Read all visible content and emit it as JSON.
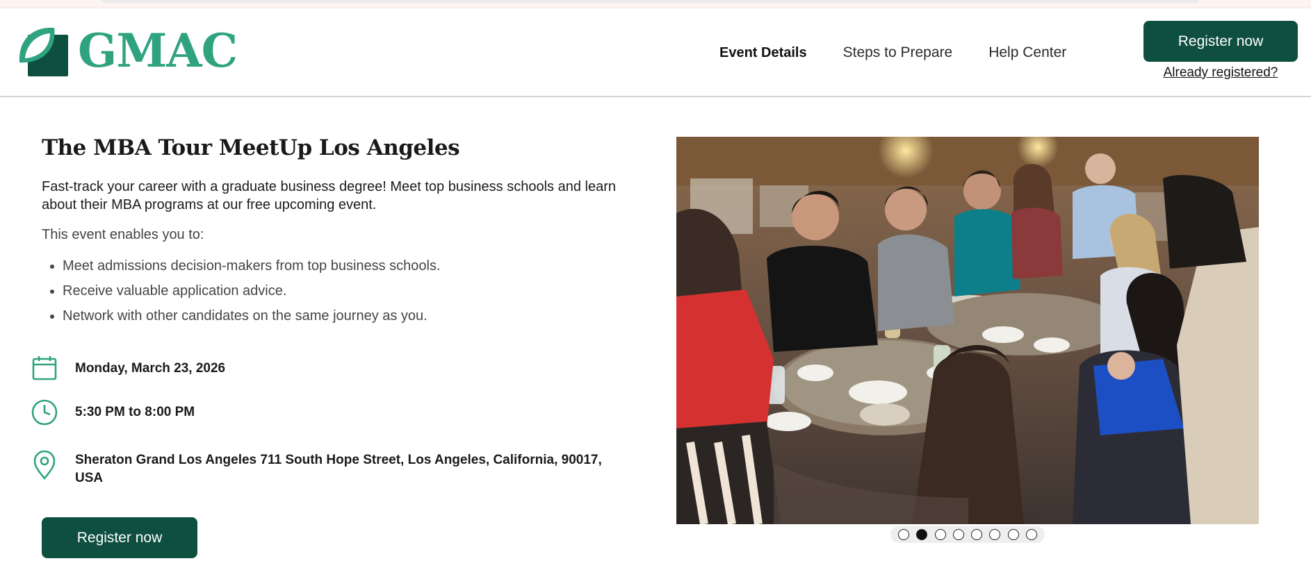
{
  "brand": {
    "name": "GMAC",
    "logo_icon": "gmac-leaf-logo",
    "primary_green": "#2fa37f",
    "dark_green": "#0e4f40"
  },
  "nav": {
    "items": [
      {
        "label": "Event Details",
        "active": true
      },
      {
        "label": "Steps to Prepare",
        "active": false
      },
      {
        "label": "Help Center",
        "active": false
      }
    ],
    "register_label": "Register now",
    "already_registered": "Already registered?"
  },
  "event": {
    "title": "The MBA Tour MeetUp Los Angeles",
    "intro": "Fast-track your career with a graduate business degree! Meet top business schools and learn about their MBA programs at our free upcoming event.",
    "enables_heading": "This event enables you to:",
    "benefits": [
      "Meet admissions decision-makers from top business schools.",
      "Receive valuable application advice.",
      "Network with other candidates on the same journey as you."
    ],
    "date": {
      "icon": "calendar-icon",
      "text": "Monday, March 23, 2026"
    },
    "time": {
      "icon": "clock-icon",
      "text": "5:30 PM to 8:00 PM"
    },
    "location": {
      "icon": "location-pin-icon",
      "text": "Sheraton Grand Los Angeles 711 South Hope Street, Los Angeles, California, 90017, USA"
    },
    "register_label": "Register now"
  },
  "carousel": {
    "slide_count": 8,
    "active_index": 1
  }
}
